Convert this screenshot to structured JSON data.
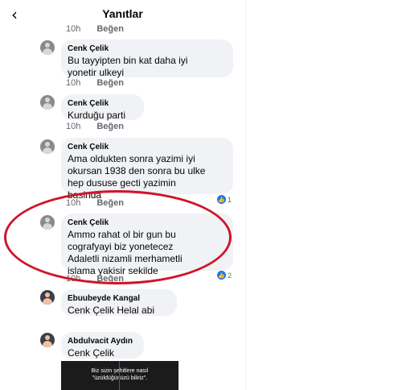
{
  "header": {
    "back_glyph": "‹",
    "title": "Yanıtlar"
  },
  "meta_labels": {
    "time": "10h",
    "like": "Beğen"
  },
  "comments": [
    {
      "author": "Cenk Çelik",
      "text": "Bu tayyipten bin kat daha iyi\nyonetir ulkeyi",
      "time": "10h",
      "like": "Beğen"
    },
    {
      "author": "Cenk Çelik",
      "text": "Kurduğu parti",
      "time": "10h",
      "like": "Beğen"
    },
    {
      "author": "Cenk Çelik",
      "text": "Ama oldukten sonra yazimi iyi\nokursan 1938 den sonra bu ulke\nhep dususe gecti yazimin\nbasinda",
      "time": "10h",
      "like": "Beğen",
      "reactions": "1"
    },
    {
      "author": "Cenk Çelik",
      "text": "Ammo rahat ol bir gun bu\ncografyayi biz yonetecez\nAdaletli nizamli merhametli\nislama yakisir sekilde",
      "time": "10h",
      "like": "Beğen",
      "reactions": "2"
    },
    {
      "author": "Ebuubeyde Kangal",
      "text": "Cenk Çelik Helal abi"
    },
    {
      "author": "Abdulvacit Aydın",
      "text": "Cenk Çelik"
    }
  ],
  "overlay": {
    "line1": "Biz sizin şehitlere nasıl",
    "line2": "\"üzüldüğünüzü biliriz\"."
  },
  "colors": {
    "highlight": "#d0142b",
    "bubble": "#f0f2f5",
    "reaction": "#1877f2",
    "meta_text": "#65676b"
  },
  "icons": {
    "back": "chevron-left-icon",
    "avatar": "avatar-icon",
    "reaction": "like-reaction-icon"
  }
}
